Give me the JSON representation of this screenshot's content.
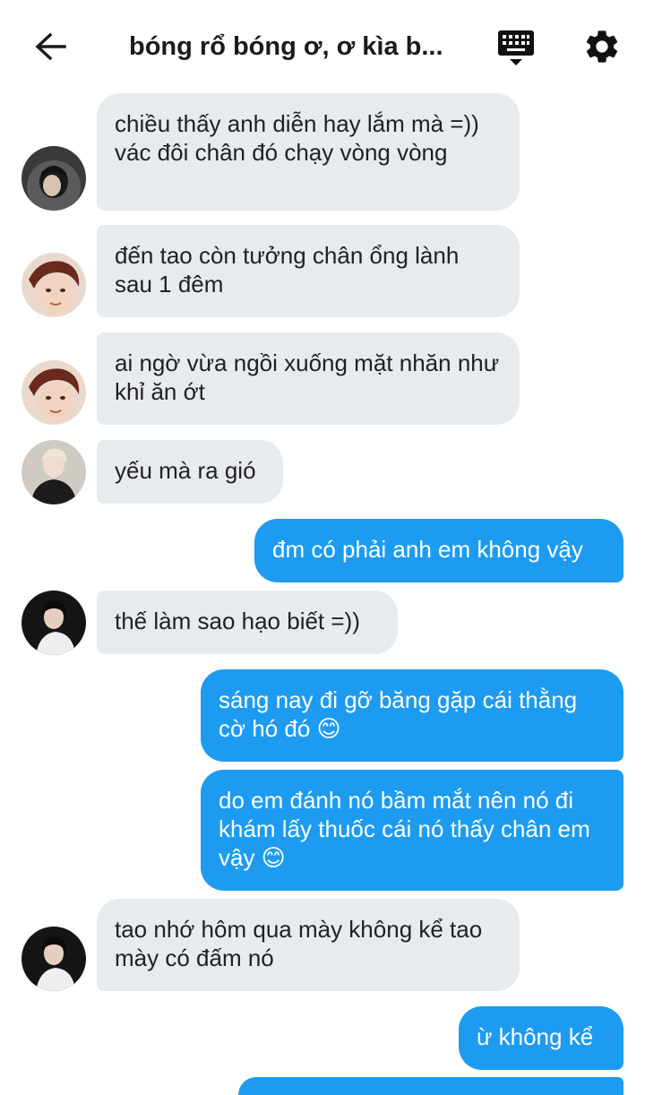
{
  "header": {
    "title": "bóng rổ bóng ơ, ơ kìa b...",
    "back_icon": "back-arrow-icon",
    "keyboard_icon": "keyboard-icon",
    "settings_icon": "gear-icon"
  },
  "colors": {
    "incoming_bubble": "#e8ebee",
    "outgoing_bubble": "#1d9bf0",
    "incoming_text": "#202124",
    "outgoing_text": "#ffffff"
  },
  "messages": [
    {
      "direction": "in",
      "avatar": "avatar-hooded",
      "text": "chiều thấy anh diễn hay lắm mà =)) vác đôi chân đó chạy vòng vòng"
    },
    {
      "direction": "in",
      "avatar": "avatar-boy-red-hair",
      "text": "đến tao còn tưởng chân ổng lành sau 1 đêm"
    },
    {
      "direction": "in",
      "avatar": "avatar-boy-red-hair",
      "text": "ai ngờ vừa ngồi xuống mặt nhăn như khỉ ăn ớt"
    },
    {
      "direction": "in",
      "avatar": "avatar-blonde-dark-suit",
      "text": "yếu mà ra gió"
    },
    {
      "direction": "out",
      "text": "đm có phải anh em không vậy"
    },
    {
      "direction": "in",
      "avatar": "avatar-dark-hair-white-shirt",
      "text": "thế làm sao hạo biết =))"
    },
    {
      "direction": "out",
      "text": "sáng nay đi gỡ băng gặp cái thằng cờ hó đó 😊"
    },
    {
      "direction": "out",
      "text": "do em đánh nó bầm mắt nên nó đi khám lấy thuốc cái nó thấy chân em vậy 😊"
    },
    {
      "direction": "in",
      "avatar": "avatar-dark-hair-white-shirt",
      "text": "tao nhớ hôm qua mày không kể tao mày có đấm nó"
    },
    {
      "direction": "out",
      "text": "ừ không kể"
    }
  ]
}
